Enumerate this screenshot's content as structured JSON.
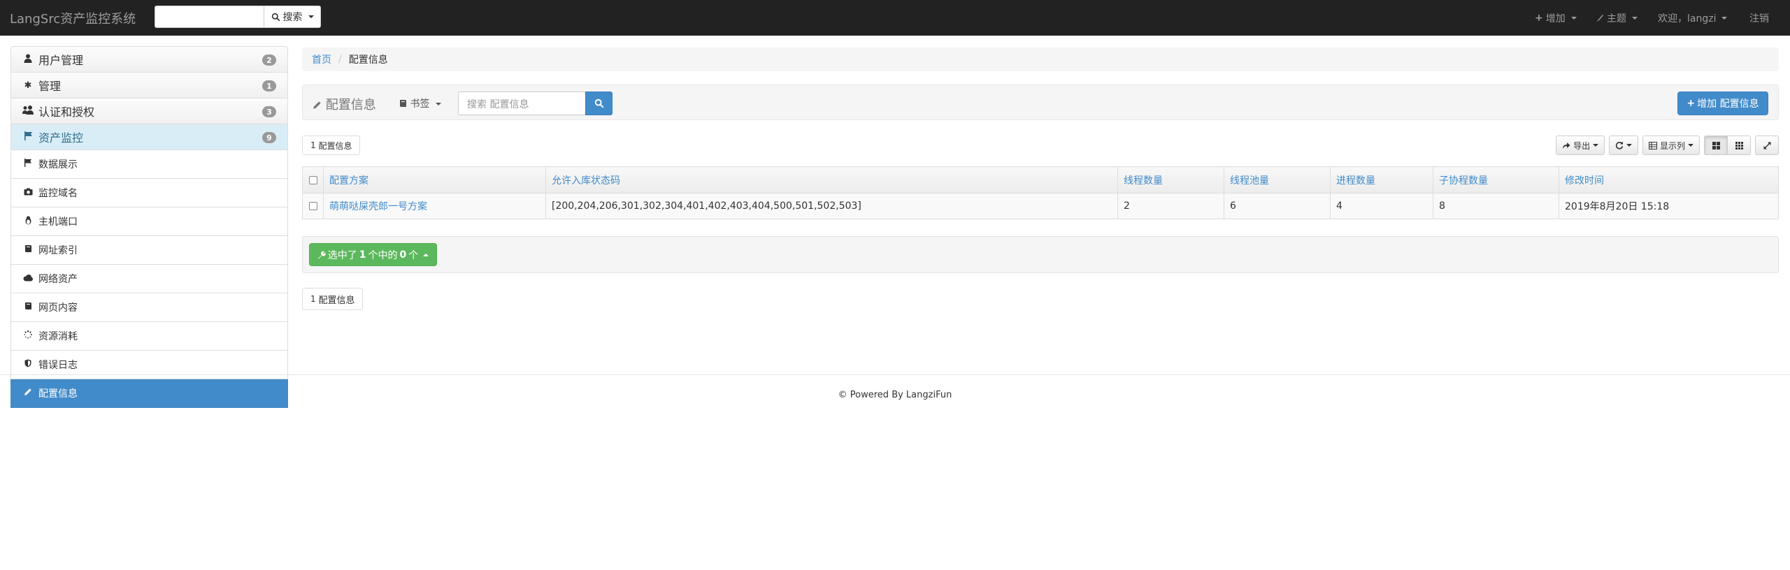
{
  "navbar": {
    "brand": "LangSrc资产监控系统",
    "search_button": "搜索",
    "add_menu": "增加",
    "theme_menu": "主题",
    "welcome": "欢迎，langzi",
    "logout": "注销"
  },
  "sidebar": {
    "groups": [
      {
        "label": "用户管理",
        "badge": "2"
      },
      {
        "label": "管理",
        "badge": "1"
      },
      {
        "label": "认证和授权",
        "badge": "3"
      },
      {
        "label": "资产监控",
        "badge": "9"
      }
    ],
    "items": [
      {
        "label": "数据展示",
        "icon": "flag-icon"
      },
      {
        "label": "监控域名",
        "icon": "camera-icon"
      },
      {
        "label": "主机端口",
        "icon": "linux-icon"
      },
      {
        "label": "网址索引",
        "icon": "book-icon"
      },
      {
        "label": "网络资产",
        "icon": "cloud-icon"
      },
      {
        "label": "网页内容",
        "icon": "book-icon"
      },
      {
        "label": "资源消耗",
        "icon": "spinner-icon"
      },
      {
        "label": "错误日志",
        "icon": "shield-icon"
      },
      {
        "label": "配置信息",
        "icon": "pencil-icon"
      }
    ]
  },
  "breadcrumb": {
    "home": "首页",
    "current": "配置信息"
  },
  "toolbar": {
    "title": "配置信息",
    "bookmark": "书签",
    "search_placeholder": "搜索 配置信息",
    "add_button": "增加 配置信息"
  },
  "count_top": {
    "count": "1",
    "label": "配置信息"
  },
  "table_tools": {
    "export": "导出",
    "columns": "显示列"
  },
  "table": {
    "headers": [
      "配置方案",
      "允许入库状态码",
      "线程数量",
      "线程池量",
      "进程数量",
      "子协程数量",
      "修改时间"
    ],
    "rows": [
      [
        "萌萌哒屎壳郎一号方案",
        "[200,204,206,301,302,304,401,402,403,404,500,501,502,503]",
        "2",
        "6",
        "4",
        "8",
        "2019年8月20日 15:18"
      ]
    ]
  },
  "action": {
    "prefix": "选中了",
    "total": "1",
    "middle": "个中的",
    "selected": "0",
    "suffix": "个"
  },
  "count_bottom": {
    "count": "1",
    "label": "配置信息"
  },
  "footer": "© Powered By LangziFun"
}
